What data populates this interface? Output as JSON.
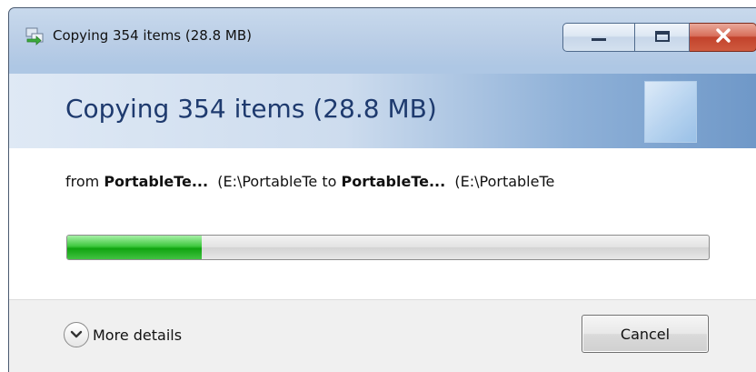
{
  "window": {
    "title": "Copying 354 items (28.8 MB)",
    "icon": "copy-arrow-icon",
    "caption_buttons": [
      "minimize-icon",
      "maximize-icon",
      "close-icon"
    ]
  },
  "header": {
    "title": "Copying 354 items (28.8 MB)"
  },
  "content": {
    "from_prefix": "from",
    "source_name": "PortableTe...",
    "source_path": "(E:\\PortableTe",
    "to_word": "to",
    "dest_name": "PortableTe...",
    "dest_path": "(E:\\PortableTe",
    "progress_fraction": 0.21
  },
  "footer": {
    "more_details_label": "More details",
    "cancel_label": "Cancel"
  },
  "colors": {
    "header_text": "#1e3a6e",
    "progress_green": "#10a410",
    "close_red": "#c2432c"
  }
}
